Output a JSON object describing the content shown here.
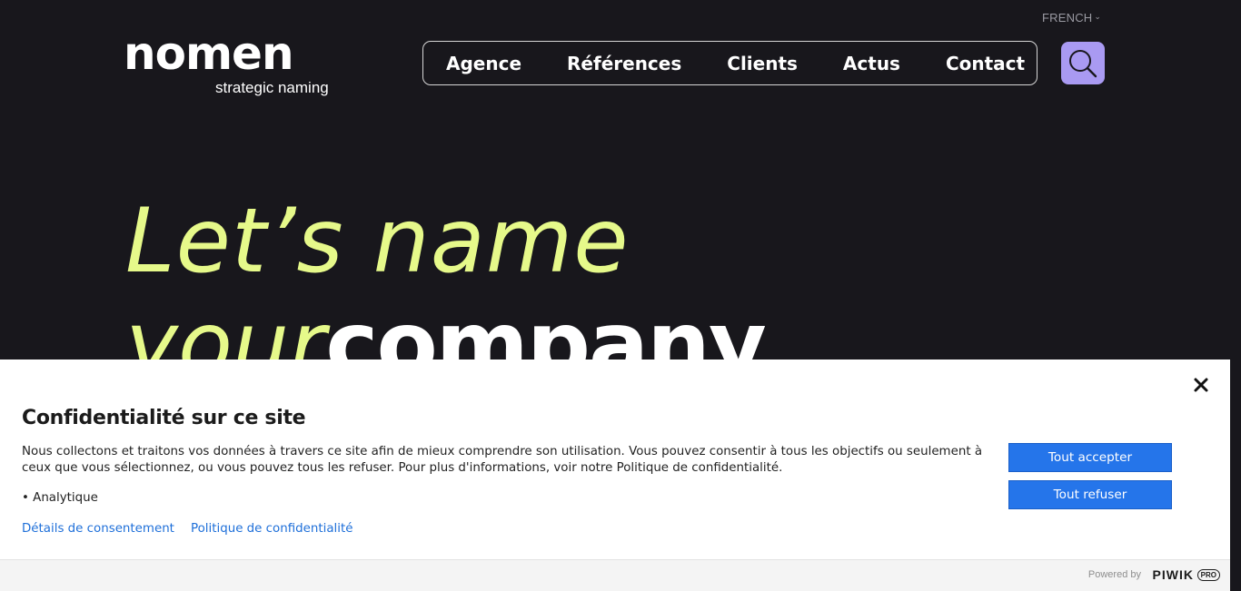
{
  "header": {
    "language": "FRENCH",
    "logo": {
      "word": "nomen",
      "tagline": "strategic naming"
    },
    "nav": [
      "Agence",
      "Références",
      "Clients",
      "Actus",
      "Contact"
    ]
  },
  "hero": {
    "line1": "Let’s name",
    "line2_light": "your",
    "line2_bold": "company"
  },
  "consent": {
    "title": "Confidentialité sur ce site",
    "body": "Nous collectons et traitons vos données à travers ce site afin de mieux comprendre son utilisation. Vous pouvez consentir à tous les objectifs ou seulement à ceux que vous sélectionnez, ou vous pouvez tous les refuser. Pour plus d'informations, voir notre Politique de confidentialité.",
    "purpose": "Analytique",
    "links": {
      "details": "Détails de consentement",
      "policy": "Politique de confidentialité"
    },
    "buttons": {
      "accept": "Tout accepter",
      "refuse": "Tout refuser"
    },
    "footer": {
      "powered": "Powered by",
      "brand": "PIWIK",
      "brand_badge": "PRO"
    }
  },
  "colors": {
    "background": "#18171c",
    "hero_accent": "#e6f98a",
    "search_button": "#a99af2",
    "consent_button": "#2575ea",
    "link": "#1e6fd9"
  },
  "icons": [
    "chevron-down-icon",
    "search-icon",
    "close-icon"
  ]
}
